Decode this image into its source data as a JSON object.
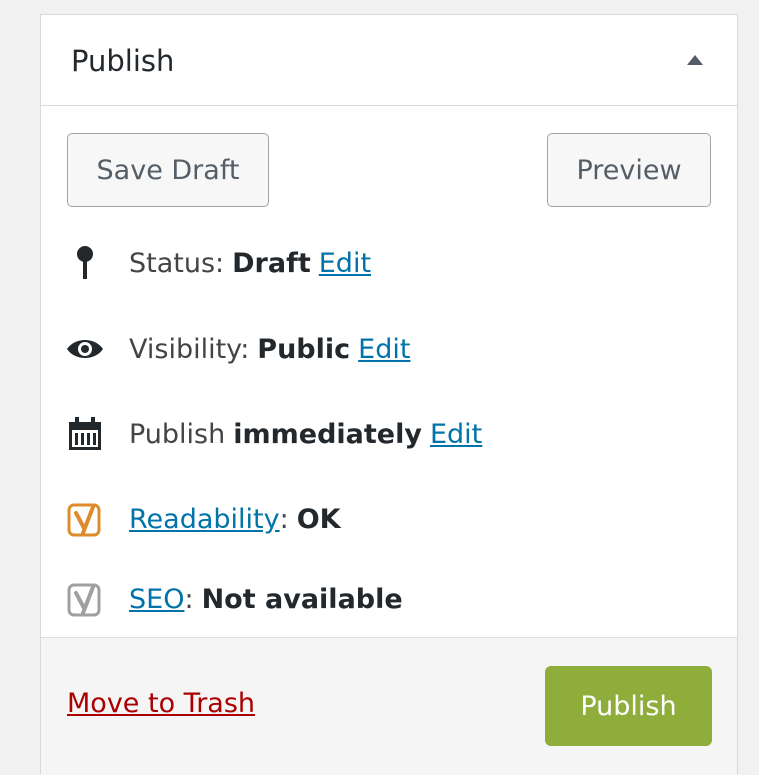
{
  "panel": {
    "title": "Publish",
    "toggle_icon": "triangle-up-icon"
  },
  "actions": {
    "save_draft_label": "Save Draft",
    "preview_label": "Preview"
  },
  "status": {
    "icon": "pin-icon",
    "label": "Status:",
    "value": "Draft",
    "edit_label": "Edit"
  },
  "visibility": {
    "icon": "eye-icon",
    "label": "Visibility:",
    "value": "Public",
    "edit_label": "Edit"
  },
  "schedule": {
    "icon": "calendar-icon",
    "label": "Publish",
    "value": "immediately",
    "edit_label": "Edit"
  },
  "readability": {
    "icon": "yoast-icon",
    "link_label": "Readability",
    "value": "OK",
    "icon_color": "#dc8c2c"
  },
  "seo": {
    "icon": "yoast-icon",
    "link_label": "SEO",
    "value": "Not available",
    "icon_color": "#a0a0a0"
  },
  "footer": {
    "trash_label": "Move to Trash",
    "publish_label": "Publish"
  },
  "colors": {
    "link": "#0073aa",
    "trash": "#a00000",
    "publish_button": "#8fad3a"
  }
}
